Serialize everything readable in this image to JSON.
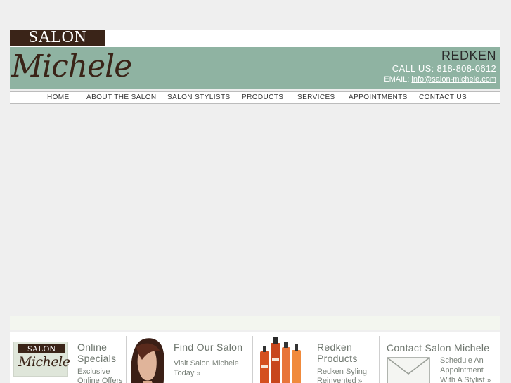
{
  "header": {
    "logo_top": "SALON",
    "logo_script": "Michele",
    "brand": "REDKEN",
    "call_label": "CALL US:",
    "phone": "818-808-0612",
    "email_label": "EMAIL:",
    "email": "info@salon-michele.com"
  },
  "nav": {
    "items": [
      {
        "label": "HOME"
      },
      {
        "label": "ABOUT THE SALON"
      },
      {
        "label": "SALON STYLISTS"
      },
      {
        "label": "PRODUCTS"
      },
      {
        "label": "SERVICES"
      },
      {
        "label": "APPOINTMENTS"
      },
      {
        "label": "CONTACT US"
      }
    ]
  },
  "footer": {
    "panels": [
      {
        "title_1": "Online",
        "title_2": "Specials",
        "text_1": "Exclusive",
        "text_2": "Online Offers",
        "logo_top": "SALON",
        "logo_script": "Michele"
      },
      {
        "title_1": "Find Our Salon",
        "text_1": "Visit Salon Michele",
        "text_2": "Today",
        "arrow": "»"
      },
      {
        "title_1": "Redken",
        "title_2": "Products",
        "text_1": "Redken Syling",
        "text_2": "Reinvented",
        "arrow": "»"
      },
      {
        "title_1": "Contact Salon Michele",
        "text_1": "Schedule An",
        "text_2": "Appointment",
        "text_3": "With A Stylist",
        "arrow": "»"
      }
    ]
  },
  "colors": {
    "banner": "#8fb3a2",
    "logo_brown": "#3a2418",
    "page_bg": "#efefef"
  }
}
